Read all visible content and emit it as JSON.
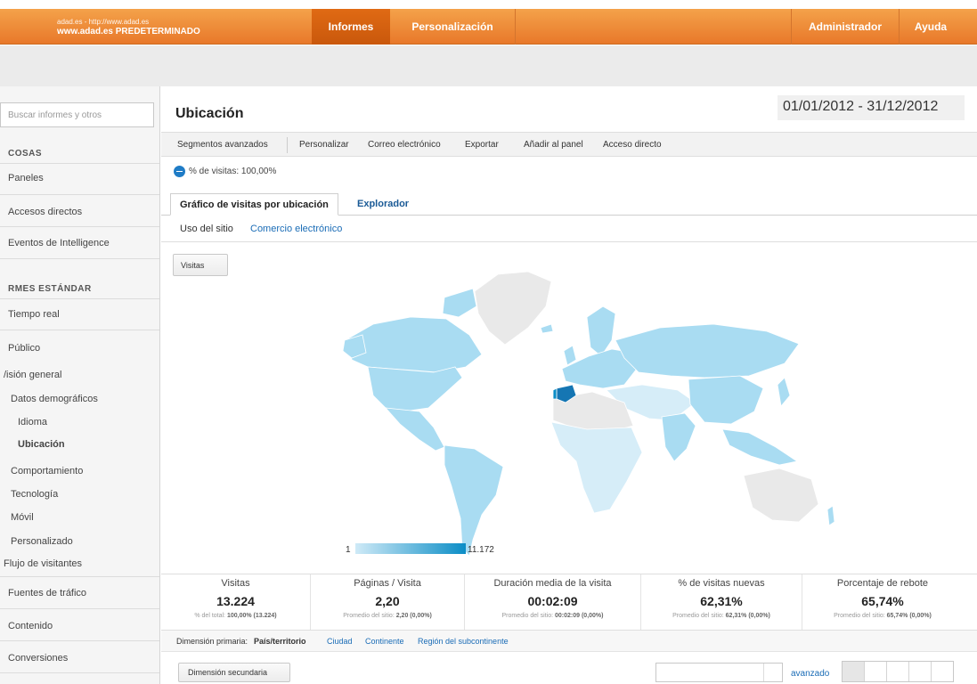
{
  "header": {
    "account_line1": "adad.es - http://www.adad.es",
    "account_line2": "www.adad.es PREDETERMINADO",
    "nav": {
      "informes": "Informes",
      "personalizacion": "Personalización",
      "administrador": "Administrador",
      "ayuda": "Ayuda"
    },
    "accent_color": "#e8782a"
  },
  "sidebar": {
    "search_placeholder": "Buscar informes y otros",
    "section_cosas": "COSAS",
    "items_top": [
      "Paneles",
      "Accesos directos",
      "Eventos de Intelligence"
    ],
    "section_standard": "RMES ESTÁNDAR",
    "tiempo_real": "Tiempo real",
    "publico": "Público",
    "vision_general": "/isión general",
    "datos_demograficos": "Datos demográficos",
    "idioma": "Idioma",
    "ubicacion": "Ubicación",
    "comportamiento": "Comportamiento",
    "tecnologia": "Tecnología",
    "movil": "Móvil",
    "personalizado": "Personalizado",
    "flujo": "Flujo de visitantes",
    "fuentes": "Fuentes de tráfico",
    "contenido": "Contenido",
    "conversiones": "Conversiones"
  },
  "main": {
    "title": "Ubicación",
    "date_range": "01/01/2012 - 31/12/2012",
    "toolbar": {
      "segmentos": "Segmentos avanzados",
      "personalizar": "Personalizar",
      "correo": "Correo electrónico",
      "exportar": "Exportar",
      "anadir": "Añadir al panel",
      "acceso": "Acceso directo"
    },
    "segment_label": "% de visitas: 100,00%",
    "tabs": {
      "grafico": "Gráfico de visitas por ubicación",
      "explorador": "Explorador"
    },
    "subtabs": {
      "uso": "Uso del sitio",
      "comercio": "Comercio electrónico"
    },
    "map": {
      "metric_button": "Visitas",
      "legend_min": "1",
      "legend_max": "11.172",
      "color_low": "#a9dcf2",
      "color_high": "#0b8dc6",
      "color_top": "#1576b3",
      "color_none": "#e9e9e9"
    },
    "metrics": [
      {
        "label": "Visitas",
        "value": "13.224",
        "sub_prefix": "% del total: ",
        "sub_bold": "100,00% (13.224)"
      },
      {
        "label": "Páginas / Visita",
        "value": "2,20",
        "sub_prefix": "Promedio del sitio: ",
        "sub_bold": "2,20 (0,00%)"
      },
      {
        "label": "Duración media de la visita",
        "value": "00:02:09",
        "sub_prefix": "Promedio del sitio: ",
        "sub_bold": "00:02:09 (0,00%)"
      },
      {
        "label": "% de visitas nuevas",
        "value": "62,31%",
        "sub_prefix": "Promedio del sitio: ",
        "sub_bold": "62,31% (0,00%)"
      },
      {
        "label": "Porcentaje de rebote",
        "value": "65,74%",
        "sub_prefix": "Promedio del sitio: ",
        "sub_bold": "65,74% (0,00%)"
      }
    ],
    "dimension": {
      "label": "Dimensión primaria:",
      "active": "País/territorio",
      "ciudad": "Ciudad",
      "continente": "Continente",
      "region": "Región del subcontinente"
    },
    "secondary_dimension": "Dimensión secundaria",
    "advanced_link": "avanzado"
  }
}
